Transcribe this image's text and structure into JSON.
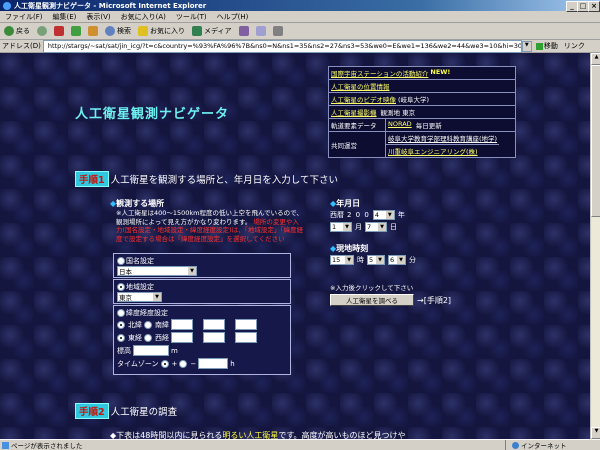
{
  "window": {
    "title": "人工衛星観測ナビゲータ - Microsoft Internet Explorer"
  },
  "menu": [
    "ファイル(F)",
    "編集(E)",
    "表示(V)",
    "お気に入り(A)",
    "ツール(T)",
    "ヘルプ(H)"
  ],
  "toolbar": {
    "back": "戻る",
    "search": "検索",
    "favorites": "お気に入り",
    "media": "メディア"
  },
  "address": {
    "label": "アドレス(D)",
    "url": "http://stargs/~sat/sat/jin_icg/?t=c&country=%93%FA%96%7B&ns0=N&ns1=35&ns2=27&ns3=53&we0=E&we1=136&we2=44&we3=10&hi=30&tzp=p&tz=9.0&dyy=p&d",
    "go": "移動",
    "links": "リンク"
  },
  "status": {
    "text": "ページが表示されました",
    "zone": "インターネット"
  },
  "page": {
    "title": "人工衛星観測ナビゲータ",
    "info": [
      {
        "text": "国際宇宙ステーションの活動紹介",
        "extra": "NEW!"
      },
      {
        "text": "人工衛星の位置情報"
      },
      {
        "text": "人工衛星のビデオ映像",
        "extra": "(岐阜大学)"
      },
      {
        "text": "人工衛星撮影機",
        "extra": "観測地 東京"
      }
    ],
    "orbit": {
      "label": "軌道要素データ",
      "link": "NORAD",
      "suffix": "毎日更新"
    },
    "joint": {
      "label": "共同運営",
      "org1": "岐阜大学教育学部理科教育講座(地学)",
      "org2": "川重岐阜エンジニアリング(株)"
    },
    "step1": {
      "badge": "手順1",
      "text": "人工衛星を観測する場所と、年月日を入力して下さい"
    },
    "place": {
      "heading": "観測する場所",
      "note1": "※人工衛星は400～1500km程度の低い上空を飛んでいるので、観測場所によって見え方がかなり変わります。",
      "note2": "場所の変更や入力(国名設定・地域設定・緯度経度設定)は、「地域設定」「緯度経度で設定する場合は「緯度経度設定」を選択してください",
      "country_label": "国名設定",
      "country_value": "日本",
      "region_label": "地域設定",
      "region_value": "東京",
      "latlon_label": "緯度経度設定",
      "north": "北緯",
      "south": "南緯",
      "east": "東経",
      "west": "西経",
      "altitude_label": "標高",
      "altitude_unit": "m",
      "tz_label": "タイムゾーン",
      "tz_plus": "+",
      "tz_minus": "−",
      "tz_unit": "h"
    },
    "date": {
      "heading": "年月日",
      "era": "西暦",
      "year": "2 0 0",
      "year_last": "4",
      "year_unit": "年",
      "month": "1",
      "month_unit": "月",
      "day": "7",
      "day_unit": "日"
    },
    "time": {
      "heading": "現地時刻",
      "hour": "15",
      "hour_unit": "時",
      "min1": "5",
      "min2": "6",
      "min_unit": "分"
    },
    "submit": {
      "note": "※入力後クリックして下さい",
      "button": "人工衛星を調べる",
      "arrow": "→[手順2]"
    },
    "step2": {
      "badge": "手順2",
      "text": "人工衛星の調査"
    },
    "bottom": {
      "text": "◆下表は48時間以内に見られる",
      "highlight": "明るい人工衛星",
      "rest": "です。高度が高いものほど見つけや"
    }
  }
}
